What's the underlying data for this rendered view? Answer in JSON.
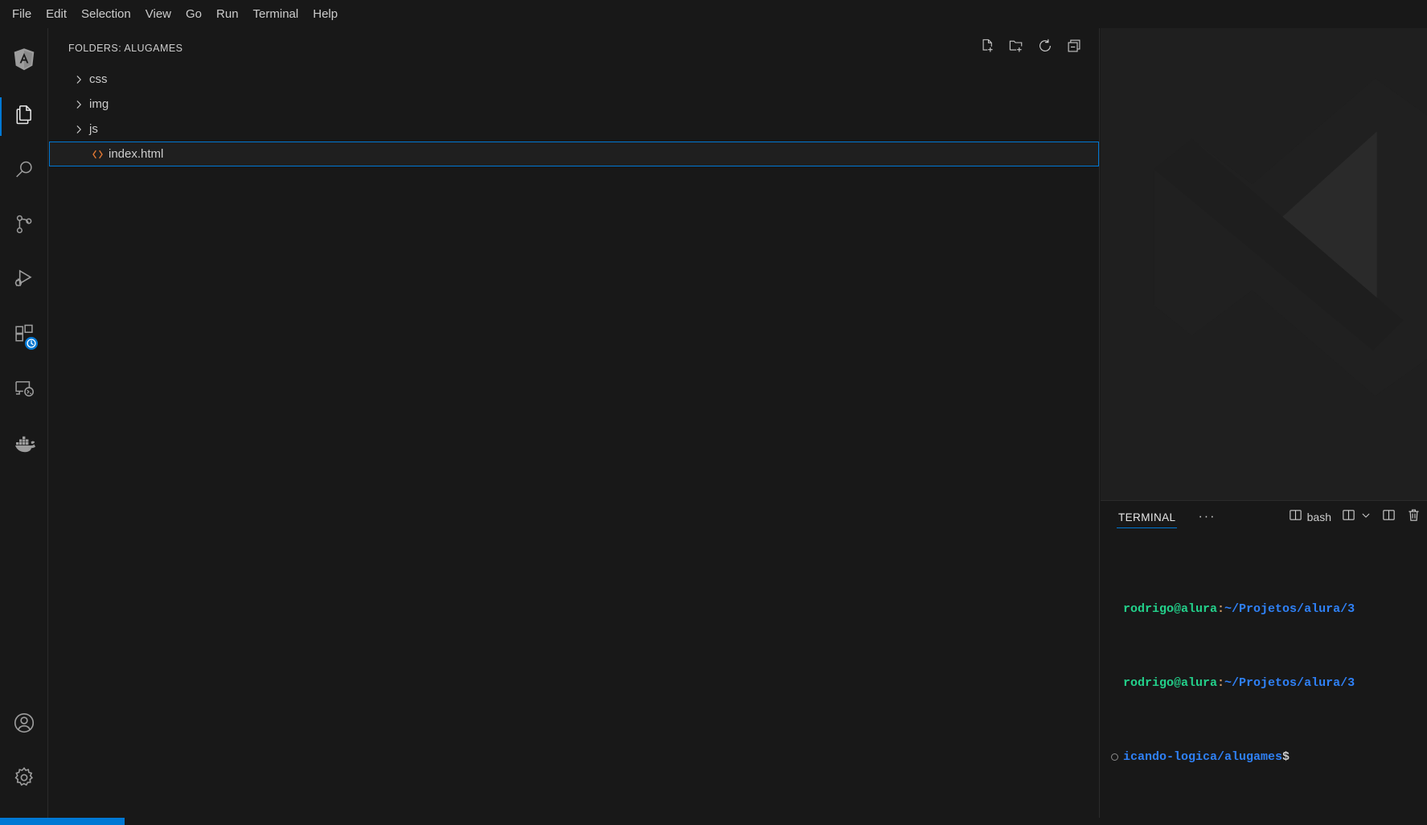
{
  "window": {
    "title": "Visual Studio Code",
    "accent_color": "#0078d4",
    "bg_color": "#181818",
    "editor_bg": "#1f1f1f",
    "text_color": "#cccccc"
  },
  "menubar": {
    "items": [
      {
        "label": "File",
        "name": "menu-file"
      },
      {
        "label": "Edit",
        "name": "menu-edit"
      },
      {
        "label": "Selection",
        "name": "menu-selection"
      },
      {
        "label": "View",
        "name": "menu-view"
      },
      {
        "label": "Go",
        "name": "menu-go"
      },
      {
        "label": "Run",
        "name": "menu-run"
      },
      {
        "label": "Terminal",
        "name": "menu-terminal"
      },
      {
        "label": "Help",
        "name": "menu-help"
      }
    ]
  },
  "activitybar": {
    "top_items": [
      {
        "icon": "angular-logo-icon",
        "label": "Angular",
        "active": false
      },
      {
        "icon": "files-explorer-icon",
        "label": "Explorer",
        "active": true
      },
      {
        "icon": "search-icon",
        "label": "Search",
        "active": false
      },
      {
        "icon": "source-control-icon",
        "label": "Source Control",
        "active": false
      },
      {
        "icon": "run-and-debug-icon",
        "label": "Run and Debug",
        "active": false
      },
      {
        "icon": "extensions-icon",
        "label": "Extensions",
        "active": false,
        "badge": "clock-badge"
      },
      {
        "icon": "remote-explorer-icon",
        "label": "Remote Explorer",
        "active": false
      },
      {
        "icon": "docker-whale-icon",
        "label": "Docker",
        "active": false
      }
    ],
    "bottom_items": [
      {
        "icon": "account-icon",
        "label": "Accounts"
      },
      {
        "icon": "gear-icon",
        "label": "Manage"
      }
    ]
  },
  "sidebar": {
    "title": "FOLDERS: ALUGAMES",
    "actions": [
      {
        "icon": "new-file-icon",
        "label": "New File..."
      },
      {
        "icon": "new-folder-icon",
        "label": "New Folder..."
      },
      {
        "icon": "refresh-icon",
        "label": "Refresh Explorer"
      },
      {
        "icon": "collapse-all-icon",
        "label": "Collapse Folders in Explorer"
      }
    ],
    "tree": [
      {
        "label": "css",
        "type": "folder",
        "expanded": false,
        "selected": false
      },
      {
        "label": "img",
        "type": "folder",
        "expanded": false,
        "selected": false
      },
      {
        "label": "js",
        "type": "folder",
        "expanded": false,
        "selected": false
      },
      {
        "label": "index.html",
        "type": "file",
        "icon": "html-file-icon",
        "selected": true
      }
    ]
  },
  "editor": {
    "watermark": "vscode-logo-watermark",
    "open_tabs": []
  },
  "panel": {
    "tab_label": "TERMINAL",
    "more_label": "···",
    "shell_label": "bash",
    "actions": [
      {
        "icon": "split-pane-icon",
        "label": "bash"
      },
      {
        "icon": "new-terminal-icon",
        "label": "Launch Profile"
      },
      {
        "icon": "chevron-down-icon",
        "label": "Launch Profile..."
      },
      {
        "icon": "split-terminal-icon",
        "label": "Split Terminal"
      },
      {
        "icon": "trash-icon",
        "label": "Kill Terminal"
      }
    ],
    "terminal_lines": [
      {
        "gutter": false,
        "parts": [
          {
            "text": "rodrigo@alura",
            "style": "user"
          },
          {
            "text": ":",
            "style": "colon"
          },
          {
            "text": "~/Projetos/alura/3",
            "style": "path"
          }
        ]
      },
      {
        "gutter": false,
        "parts": [
          {
            "text": "rodrigo@alura",
            "style": "user"
          },
          {
            "text": ":",
            "style": "colon"
          },
          {
            "text": "~/Projetos/alura/3",
            "style": "path"
          }
        ]
      },
      {
        "gutter": true,
        "parts": [
          {
            "text": "icando-logica/alugames",
            "style": "path"
          },
          {
            "text": "$",
            "style": "dollar"
          }
        ]
      }
    ]
  },
  "statusbar": {
    "remote_label": "",
    "items": []
  }
}
